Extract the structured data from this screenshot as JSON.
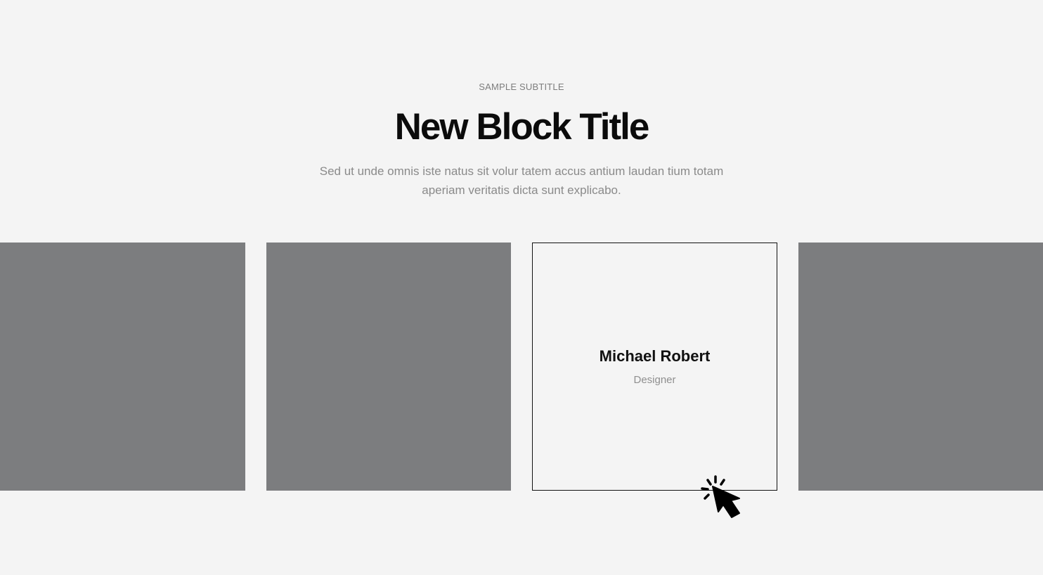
{
  "section": {
    "subtitle": "SAMPLE SUBTITLE",
    "title": "New Block Title",
    "description": "Sed ut unde omnis iste natus sit volur tatem accus antium laudan tium totam aperiam veritatis dicta sunt explicabo."
  },
  "team": {
    "active_card": {
      "name": "Michael Robert",
      "role": "Designer"
    }
  },
  "colors": {
    "background": "#f4f4f4",
    "card_placeholder": "#7c7d7f",
    "title": "#0b0b0b",
    "muted_text": "#8a8a8a"
  },
  "icons": {
    "cursor": "click-cursor-icon"
  }
}
